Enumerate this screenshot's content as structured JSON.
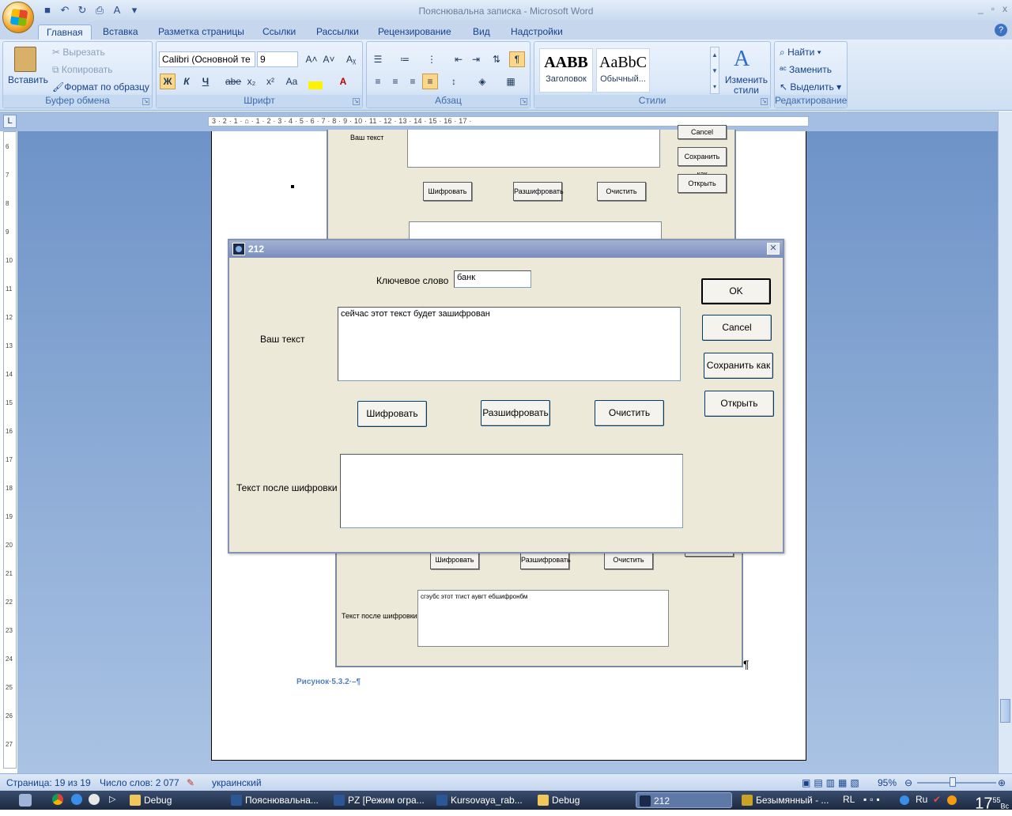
{
  "window": {
    "title": "Пояснювальна записка - Microsoft Word",
    "controls": [
      "_",
      "▫",
      "x"
    ]
  },
  "tabs": [
    "Главная",
    "Вставка",
    "Разметка страницы",
    "Ссылки",
    "Рассылки",
    "Рецензирование",
    "Вид",
    "Надстройки"
  ],
  "ribbon": {
    "clipboard": {
      "paste": "Вставить",
      "cut": "Вырезать",
      "copy": "Копировать",
      "format_painter": "Формат по образцу",
      "label": "Буфер обмена"
    },
    "font": {
      "name": "Calibri (Основной те",
      "size": "9",
      "label": "Шрифт",
      "bold": "Ж",
      "italic": "К",
      "underline": "Ч",
      "strike": "abe",
      "subscript": "x₂",
      "superscript": "x²",
      "case": "Aa"
    },
    "paragraph": {
      "label": "Абзац"
    },
    "styles": {
      "items": [
        {
          "sample": "AABB",
          "name": "Заголовок"
        },
        {
          "sample": "AaBbC",
          "name": "Обычный..."
        }
      ],
      "change_styles": "Изменить стили",
      "label": "Стили"
    },
    "editing": {
      "find": "Найти",
      "replace": "Заменить",
      "select": "Выделить",
      "label": "Редактирование"
    }
  },
  "ruler": {
    "ticks": "3 · 2 · 1 · ⌂ · 1 · 2 · 3 · 4 · 5 · 6 · 7 · 8 · 9 · 10 · 11 · 12 · 13 · 14 · 15 · 16 · 17 ·",
    "v_ticks": [
      "6",
      "7",
      "8",
      "9",
      "10",
      "11",
      "12",
      "13",
      "14",
      "15",
      "16",
      "17",
      "18",
      "19",
      "20",
      "21",
      "22",
      "23",
      "24",
      "25",
      "26",
      "27"
    ]
  },
  "embedded": {
    "your_text": "Ваш текст",
    "cancel": "Cancel",
    "save_as": "Сохранить как",
    "open": "Открыть",
    "encrypt": "Шифровать",
    "decrypt": "Разшифровать",
    "clear": "Очистить",
    "after": "Текст после шифровки",
    "cipher_text": "сгэубс этот тгист аувгт ебшифронбм",
    "caption": "Рисунок·5.3.2·–¶",
    "pilcrow": "¶"
  },
  "dialog": {
    "title": "212",
    "keyword_label": "Ключевое слово",
    "keyword_value": "банк",
    "text_label": "Ваш текст",
    "text_value": "сейчас этот текст будет зашифрован",
    "after_label": "Текст после шифровки",
    "after_value": "",
    "ok": "OK",
    "cancel": "Cancel",
    "save_as": "Сохранить как",
    "open": "Открыть",
    "encrypt": "Шифровать",
    "decrypt": "Разшифровать",
    "clear": "Очистить"
  },
  "status": {
    "page": "Страница: 19 из 19",
    "words": "Число слов: 2 077",
    "language": "украинский",
    "zoom": "95%"
  },
  "taskbar": {
    "tasks": [
      "Debug",
      "Пояснювальна...",
      "PZ [Режим огра...",
      "Kursovaya_rab...",
      "Debug",
      "212",
      "Безымянный - ..."
    ],
    "lang": "RL",
    "ime": "Ru",
    "clock_h": "17",
    "clock_m": "55",
    "clock_day": "Вс"
  }
}
